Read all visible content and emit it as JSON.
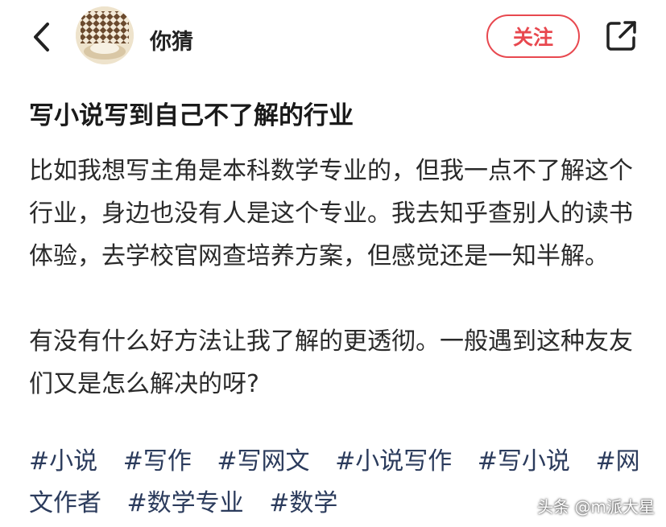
{
  "header": {
    "username": "你猜",
    "follow_label": "关注"
  },
  "post": {
    "title": "写小说写到自己不了解的行业",
    "paragraphs": [
      "比如我想写主角是本科数学专业的，但我一点不了解这个行业，身边也没有人是这个专业。我去知乎查别人的读书体验，去学校官网查培养方案，但感觉还是一知半解。",
      "有没有什么好方法让我了解的更透彻。一般遇到这种友友们又是怎么解决的呀?"
    ],
    "tags": [
      "#小说",
      "#写作",
      "#写网文",
      "#小说写作",
      "#写小说",
      "#网文作者",
      "#数学专业",
      "#数学"
    ]
  },
  "watermark": "头条 @m派大星",
  "colors": {
    "accent": "#e8484f",
    "tag_text": "#2b3b5c"
  },
  "icons": {
    "back": "chevron-left-icon",
    "share": "share-icon"
  }
}
